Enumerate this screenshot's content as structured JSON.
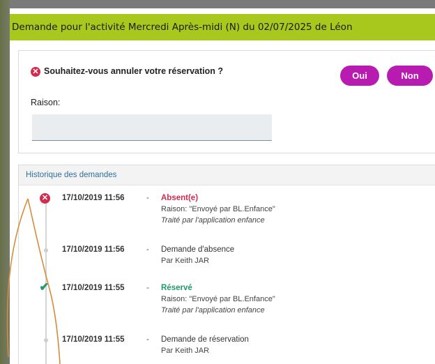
{
  "dialog": {
    "title": "Demande pour l'activité Mercredi Après-midi (N) du 02/07/2025 de Léon"
  },
  "cancel_request": {
    "question": "Souhaitez-vous annuler votre réservation ?",
    "yes_label": "Oui",
    "no_label": "Non",
    "reason_label": "Raison:",
    "reason_value": ""
  },
  "history": {
    "title": "Historique des demandes",
    "entries": [
      {
        "icon": "cross-circle-icon",
        "date": "17/10/2019 11:56",
        "separator": "-",
        "status": "Absent(e)",
        "line2": "Raison: \"Envoyé par BL.Enfance\"",
        "line3": "Traité par l'application enfance"
      },
      {
        "icon": "dot-icon",
        "date": "17/10/2019 11:56",
        "separator": "-",
        "status": "Demande d'absence",
        "line2": "Par Keith JAR"
      },
      {
        "icon": "checkmark-icon",
        "date": "17/10/2019 11:55",
        "separator": "-",
        "status": "Réservé",
        "line2": "Raison: \"Envoyé par BL.Enfance\"",
        "line3": "Traité par l'application enfance"
      },
      {
        "icon": "dot-icon",
        "date": "17/10/2019 11:55",
        "separator": "-",
        "status": "Demande de réservation",
        "line2": "Par Keith JAR"
      }
    ]
  },
  "colors": {
    "header": "#a9c81e",
    "button": "#b81bb0",
    "absent": "#d32b4b",
    "reserved": "#1f9a6a",
    "link": "#2f6f9c",
    "annotation_arrow": "#d98a3a"
  }
}
